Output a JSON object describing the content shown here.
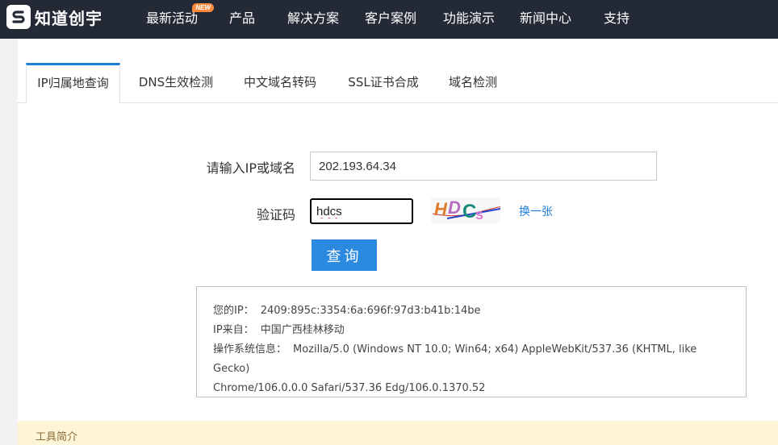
{
  "brand": {
    "name": "知道创宇",
    "logo_icon": "s-logo-icon"
  },
  "nav": {
    "items": [
      {
        "label": "最新活动",
        "badge": "NEW"
      },
      {
        "label": "产品"
      },
      {
        "label": "解决方案"
      },
      {
        "label": "客户案例"
      },
      {
        "label": "功能演示"
      },
      {
        "label": "新闻中心"
      },
      {
        "label": "支持"
      }
    ]
  },
  "tabs": [
    {
      "label": "IP归属地查询",
      "active": true
    },
    {
      "label": "DNS生效检测"
    },
    {
      "label": "中文域名转码"
    },
    {
      "label": "SSL证书合成"
    },
    {
      "label": "域名检测"
    }
  ],
  "form": {
    "ip_label": "请输入IP或域名",
    "ip_value": "202.193.64.34",
    "code_label": "验证码",
    "code_value": "hdcs",
    "captcha_text": "HDCs",
    "refresh_label": "换一张",
    "submit_label": "查询"
  },
  "result": {
    "your_ip_label": "您的IP：",
    "your_ip": "2409:895c:3354:6a:696f:97d3:b41b:14be",
    "source_label": "IP来自：",
    "source": "中国广西桂林移动",
    "os_label": "操作系统信息：",
    "os_line1": "Mozilla/5.0 (Windows NT 10.0; Win64; x64) AppleWebKit/537.36 (KHTML, like Gecko)",
    "os_line2": "Chrome/106.0.0.0 Safari/537.36 Edg/106.0.1370.52"
  },
  "intro": {
    "title": "工具简介"
  },
  "colors": {
    "nav_bg": "#232a36",
    "accent": "#2b8ae0",
    "intro_bg": "#fdf5d6"
  }
}
